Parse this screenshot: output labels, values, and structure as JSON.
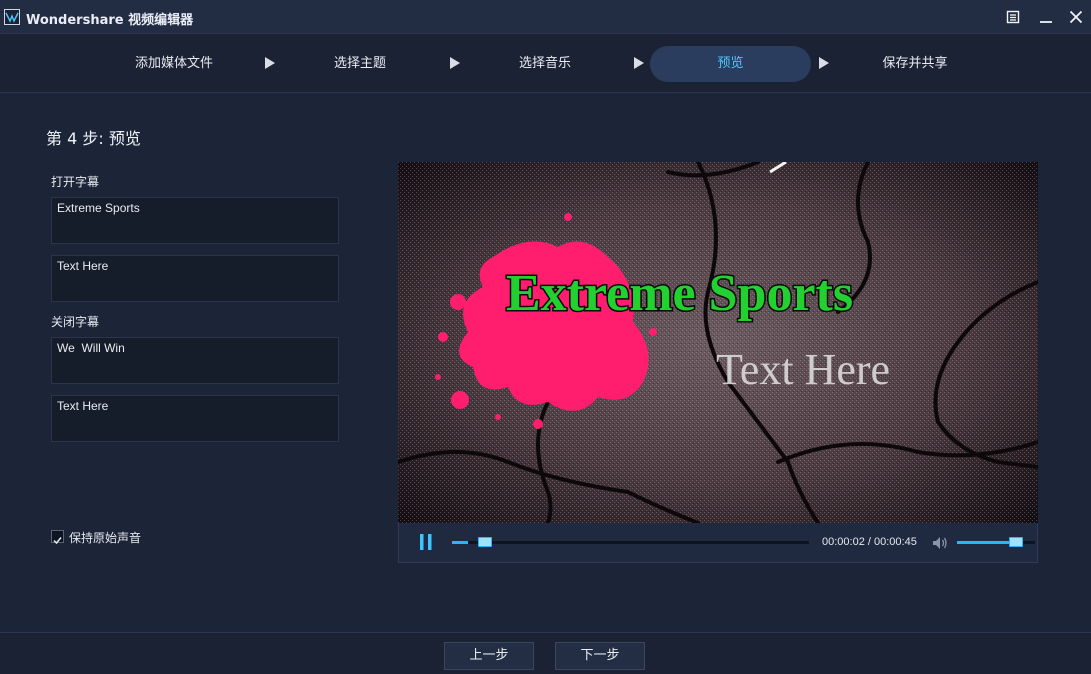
{
  "app": {
    "title": "Wondershare 视频编辑器"
  },
  "steps": [
    {
      "label": "添加媒体文件",
      "active": false
    },
    {
      "label": "选择主题",
      "active": false
    },
    {
      "label": "选择音乐",
      "active": false
    },
    {
      "label": "预览",
      "active": true
    },
    {
      "label": "保存并共享",
      "active": false
    }
  ],
  "page": {
    "heading": "第 4 步: 预览",
    "opening_captions_label": "打开字幕",
    "opening_captions": [
      "Extreme Sports",
      "Text Here"
    ],
    "closing_captions_label": "关闭字幕",
    "closing_captions": [
      "We  Will Win",
      "Text Here"
    ],
    "keep_audio": {
      "label": "保持原始声音",
      "checked": true
    }
  },
  "video": {
    "title_text": "Extreme Sports",
    "subtitle_text": "Text Here",
    "current_time": "00:00:02",
    "total_time": "00:00:45",
    "time_display": "00:00:02 / 00:00:45",
    "progress": 0.044,
    "volume": 0.75
  },
  "footer": {
    "prev_label": "上一步",
    "next_label": "下一步"
  },
  "colors": {
    "accent": "#2ab4ff",
    "active_step_text": "#4fc7ff",
    "title_green": "#22d12f",
    "splash_pink": "#ff1d6e"
  }
}
